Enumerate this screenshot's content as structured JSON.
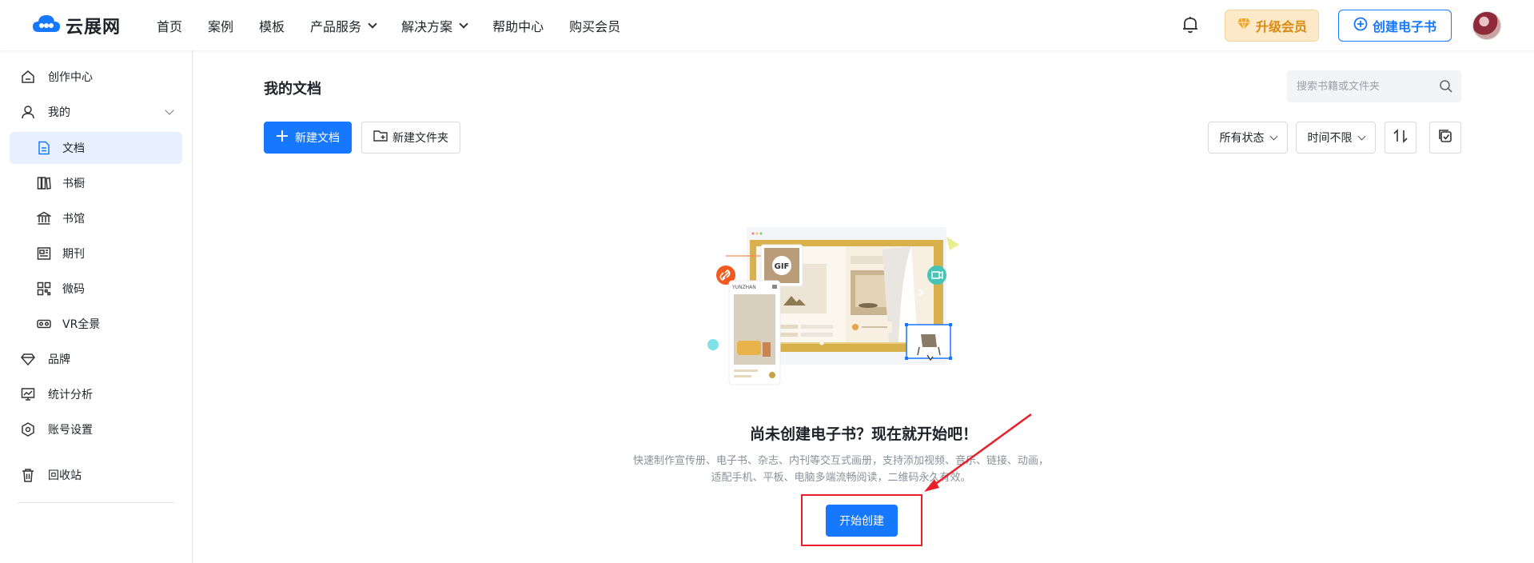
{
  "brand": {
    "name": "云展网"
  },
  "nav": {
    "items": [
      {
        "label": "首页",
        "dropdown": false
      },
      {
        "label": "案例",
        "dropdown": false
      },
      {
        "label": "模板",
        "dropdown": false
      },
      {
        "label": "产品服务",
        "dropdown": true
      },
      {
        "label": "解决方案",
        "dropdown": true
      },
      {
        "label": "帮助中心",
        "dropdown": false
      },
      {
        "label": "购买会员",
        "dropdown": false
      }
    ]
  },
  "header": {
    "upgrade_label": "升级会员",
    "create_book_label": "创建电子书"
  },
  "sidebar": {
    "items": [
      {
        "label": "创作中心",
        "icon": "home-icon"
      },
      {
        "label": "我的",
        "icon": "user-icon",
        "expanded": true
      },
      {
        "label": "文档",
        "icon": "document-icon",
        "active": true
      },
      {
        "label": "书橱",
        "icon": "bookshelf-icon"
      },
      {
        "label": "书馆",
        "icon": "library-icon"
      },
      {
        "label": "期刊",
        "icon": "journal-icon"
      },
      {
        "label": "微码",
        "icon": "qrcode-icon"
      },
      {
        "label": "VR全景",
        "icon": "vr-icon"
      },
      {
        "label": "品牌",
        "icon": "diamond-icon"
      },
      {
        "label": "统计分析",
        "icon": "chart-icon"
      },
      {
        "label": "账号设置",
        "icon": "settings-icon"
      },
      {
        "label": "回收站",
        "icon": "trash-icon"
      }
    ]
  },
  "main": {
    "title": "我的文档",
    "search_placeholder": "搜索书籍或文件夹",
    "new_doc_label": "新建文档",
    "new_folder_label": "新建文件夹",
    "filter_status": "所有状态",
    "filter_time": "时间不限",
    "empty": {
      "title": "尚未创建电子书？现在就开始吧！",
      "desc_line1": "快速制作宣传册、电子书、杂志、内刊等交互式画册，支持添加视频、音乐、链接、动画，",
      "desc_line2": "适配手机、平板、电脑多端流畅阅读，二维码永久有效。",
      "start_label": "开始创建"
    },
    "illustration": {
      "gif_label": "GIF",
      "mini_brand": "YUNZHAN"
    }
  },
  "colors": {
    "primary": "#1677ff",
    "gold": "#d9b24a",
    "annotation": "#e8202a"
  }
}
